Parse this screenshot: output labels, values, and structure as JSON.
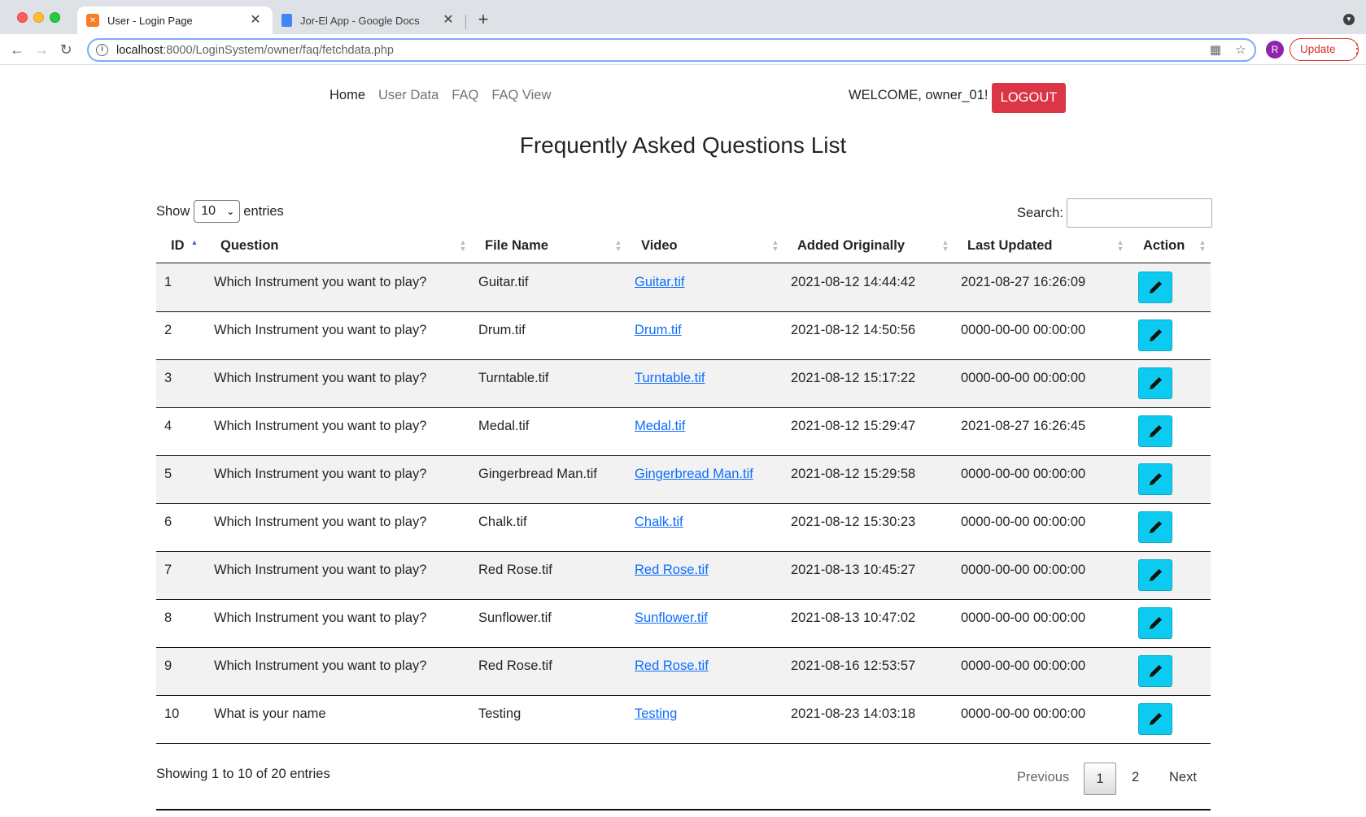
{
  "browser": {
    "tabs": [
      {
        "title": "User - Login Page",
        "active": true,
        "favicon": "xampp-icon"
      },
      {
        "title": "Jor-El App - Google Docs",
        "active": false,
        "favicon": "docs-icon"
      }
    ],
    "url_host": "localhost",
    "url_path": ":8000/LoginSystem/owner/faq/fetchdata.php",
    "profile_initial": "R",
    "update_label": "Update"
  },
  "nav": {
    "links": [
      "Home",
      "User Data",
      "FAQ",
      "FAQ View"
    ],
    "welcome": "WELCOME, owner_01! -",
    "logout_label": "LOGOUT"
  },
  "page_title": "Frequently Asked Questions List",
  "datatable": {
    "length_prefix": "Show",
    "length_value": "10",
    "length_suffix": "entries",
    "search_label": "Search:",
    "search_value": "",
    "columns": [
      "ID",
      "Question",
      "File Name",
      "Video",
      "Added Originally",
      "Last Updated",
      "Action"
    ],
    "rows": [
      {
        "id": "1",
        "question": "Which Instrument you want to play?",
        "file": "Guitar.tif",
        "video": "Guitar.tif",
        "added": "2021-08-12 14:44:42",
        "updated": "2021-08-27 16:26:09"
      },
      {
        "id": "2",
        "question": "Which Instrument you want to play?",
        "file": "Drum.tif",
        "video": "Drum.tif",
        "added": "2021-08-12 14:50:56",
        "updated": "0000-00-00 00:00:00"
      },
      {
        "id": "3",
        "question": "Which Instrument you want to play?",
        "file": "Turntable.tif",
        "video": "Turntable.tif",
        "added": "2021-08-12 15:17:22",
        "updated": "0000-00-00 00:00:00"
      },
      {
        "id": "4",
        "question": "Which Instrument you want to play?",
        "file": "Medal.tif",
        "video": "Medal.tif",
        "added": "2021-08-12 15:29:47",
        "updated": "2021-08-27 16:26:45"
      },
      {
        "id": "5",
        "question": "Which Instrument you want to play?",
        "file": "Gingerbread Man.tif",
        "video": "Gingerbread Man.tif",
        "added": "2021-08-12 15:29:58",
        "updated": "0000-00-00 00:00:00"
      },
      {
        "id": "6",
        "question": "Which Instrument you want to play?",
        "file": "Chalk.tif",
        "video": "Chalk.tif",
        "added": "2021-08-12 15:30:23",
        "updated": "0000-00-00 00:00:00"
      },
      {
        "id": "7",
        "question": "Which Instrument you want to play?",
        "file": "Red Rose.tif",
        "video": "Red Rose.tif",
        "added": "2021-08-13 10:45:27",
        "updated": "0000-00-00 00:00:00"
      },
      {
        "id": "8",
        "question": "Which Instrument you want to play?",
        "file": "Sunflower.tif",
        "video": "Sunflower.tif",
        "added": "2021-08-13 10:47:02",
        "updated": "0000-00-00 00:00:00"
      },
      {
        "id": "9",
        "question": "Which Instrument you want to play?",
        "file": "Red Rose.tif",
        "video": "Red Rose.tif",
        "added": "2021-08-16 12:53:57",
        "updated": "0000-00-00 00:00:00"
      },
      {
        "id": "10",
        "question": "What is your name",
        "file": "Testing",
        "video": "Testing",
        "added": "2021-08-23 14:03:18",
        "updated": "0000-00-00 00:00:00"
      }
    ],
    "info": "Showing 1 to 10 of 20 entries",
    "pagination": {
      "previous": "Previous",
      "pages": [
        "1",
        "2"
      ],
      "current": "1",
      "next": "Next"
    }
  },
  "colors": {
    "logout": "#dc3545",
    "edit_button": "#0dcaf0",
    "link": "#0d6efd"
  }
}
